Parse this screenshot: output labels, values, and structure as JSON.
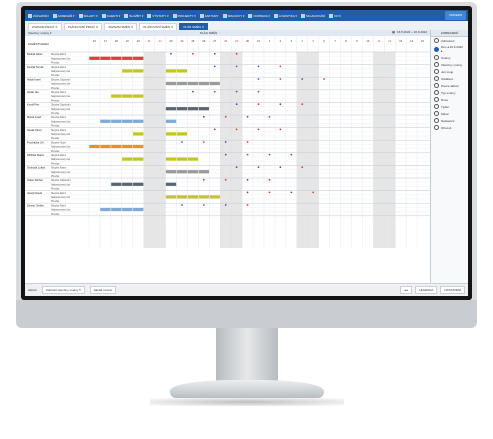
{
  "topbar": {
    "menu": [
      "ZÁKAZNÍCI",
      "ADRESÁŘ ▾",
      "SKLADY ▾",
      "KLIENTI ▾",
      "SLUŽBY ▾",
      "VÝSTUPY ▾",
      "PROJEKTY ▾",
      "FAKTURY",
      "SMLOUVY ▾",
      "DOPRAVA ▾",
      "LOGISTIKA ▾",
      "SKLADOVÁNÍ",
      "CO ▾"
    ],
    "orders_button": "ORDERS",
    "accent": "#1e5fa8"
  },
  "tabs": [
    {
      "label": "ZÁZNAM PRACÍ ✕",
      "active": false
    },
    {
      "label": "PLÁNOVÁNÍ PRACÍ ✕",
      "active": false
    },
    {
      "label": "ZÁZNAM SMĚN ✕",
      "active": false
    },
    {
      "label": "PLÁNOVÁNÍ SMĚN ✕",
      "active": false
    },
    {
      "label": "PLÁN SMĚN ✕",
      "active": true
    }
  ],
  "grid": {
    "filter_label": "Všechny směny ▾",
    "section_title": "PLÁN SMĚN",
    "range_label": "16.5.2022 – 16.6.2022",
    "name_col_label": "ZAMĚSTNANEC",
    "days": 31,
    "weekend_cols": [
      5,
      6,
      12,
      13,
      19,
      20,
      26,
      27
    ],
    "employees": [
      {
        "name": "Bednář Adam",
        "rows": [
          "Skupina Ranní",
          "Nadpracovaný čas",
          "Přesčas"
        ]
      },
      {
        "name": "Dvořák Tomáš",
        "rows": [
          "Skupina Ranní",
          "Nadpracovaný čas",
          "Přesčas"
        ]
      },
      {
        "name": "Holub Karel",
        "rows": [
          "Skupina Odpolední",
          "Nadpracovaný čas",
          "Přesčas"
        ]
      },
      {
        "name": "Horák Jan",
        "rows": [
          "Skupina Ranní",
          "Nadpracovaný čas",
          "Přesčas"
        ]
      },
      {
        "name": "Kovář Petr",
        "rows": [
          "Skupina Odpolední",
          "Nadpracovaný čas",
          "Přesčas"
        ]
      },
      {
        "name": "Marek Josef",
        "rows": [
          "Skupina Ranní",
          "Nadpracovaný čas",
          "Přesčas"
        ]
      },
      {
        "name": "Novák Pavel",
        "rows": [
          "Skupina Ranní",
          "Nadpracovaný čas",
          "Přesčas"
        ]
      },
      {
        "name": "Procházka Jiří",
        "rows": [
          "Skupina Noční",
          "Nadpracovaný čas",
          "Přesčas"
        ]
      },
      {
        "name": "Růžička Martin",
        "rows": [
          "Skupina Ranní",
          "Nadpracovaný čas",
          "Přesčas"
        ]
      },
      {
        "name": "Svoboda Lukáš",
        "rows": [
          "Skupina Ranní",
          "Nadpracovaný čas",
          "Přesčas"
        ]
      },
      {
        "name": "Urban Michal",
        "rows": [
          "Skupina Odpolední",
          "Nadpracovaný čas",
          "Přesčas"
        ]
      },
      {
        "name": "Veselý David",
        "rows": [
          "Skupina Ranní",
          "Nadpracovaný čas",
          "Přesčas"
        ]
      },
      {
        "name": "Zeman Ondřej",
        "rows": [
          "Skupina Ranní",
          "Nadpracovaný čas",
          "Přesčas"
        ]
      }
    ],
    "colors": {
      "red": "#e23b3b",
      "olive": "#c4c42a",
      "orange": "#f28c1b",
      "green": "#3fbf6a",
      "blue": "#7fa9d6",
      "gray": "#9a9a9a",
      "dark": "#5c6670",
      "weekend": "#e6e6e6"
    }
  },
  "panel": {
    "title": "ZOBRAZENÍ",
    "labels": [
      "Zobrazení",
      "Den ◂ 16.6.2022 ▸",
      "Směny",
      "Všechny směny",
      "Jen moje",
      "Oddělení",
      "Pouze aktivní",
      "Typ směny",
      "Dnes",
      "Týden",
      "Měsíc",
      "Nastavení",
      "Obnovit"
    ],
    "radios_on": [
      1
    ]
  },
  "status": {
    "left": "Aktivní",
    "filter": "Zobrazit všechny směny ▾",
    "search": "Hledat směnu",
    "right": [
      "◂ ▸",
      "LEGENDA",
      "NASTAVENÍ"
    ]
  }
}
